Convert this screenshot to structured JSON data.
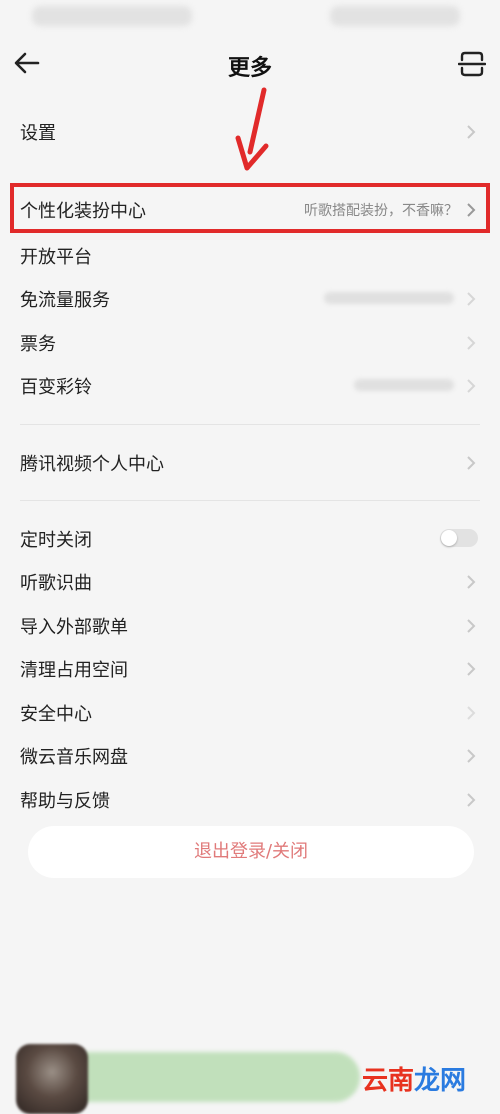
{
  "header": {
    "title": "更多"
  },
  "rows": {
    "settings": {
      "label": "设置"
    },
    "personalization": {
      "label": "个性化装扮中心",
      "hint": "听歌搭配装扮，不香嘛？"
    },
    "open_platform": {
      "label": "开放平台"
    },
    "free_data": {
      "label": "免流量服务"
    },
    "tickets": {
      "label": "票务"
    },
    "ringtone": {
      "label": "百变彩铃"
    },
    "tencent_video": {
      "label": "腾讯视频个人中心"
    },
    "sleep_timer": {
      "label": "定时关闭",
      "enabled": false
    },
    "song_recognition": {
      "label": "听歌识曲"
    },
    "import_playlist": {
      "label": "导入外部歌单"
    },
    "clear_storage": {
      "label": "清理占用空间"
    },
    "security_center": {
      "label": "安全中心"
    },
    "weiyun_disk": {
      "label": "微云音乐网盘"
    },
    "help_feedback": {
      "label": "帮助与反馈"
    }
  },
  "logout": {
    "label": "退出登录/关闭"
  },
  "watermark": {
    "part1": "云南",
    "part2": "龙网"
  },
  "colors": {
    "annotation_red": "#e12a2a",
    "logout_text": "#e07a7a",
    "player_green": "#b9ddb2"
  },
  "icons": {
    "back": "back-arrow-icon",
    "scan": "scan-icon",
    "chevron": "chevron-right-icon"
  }
}
